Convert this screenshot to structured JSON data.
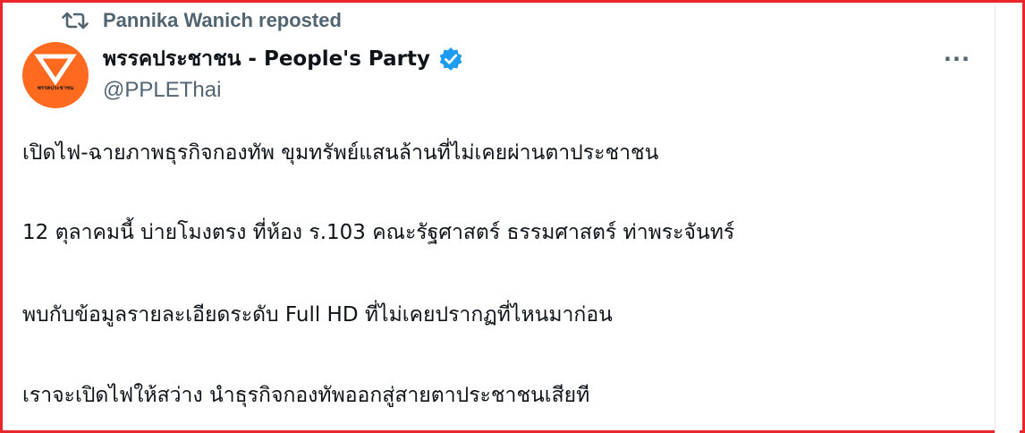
{
  "repost": {
    "icon": "repost-icon",
    "text": "Pannika Wanich reposted"
  },
  "author": {
    "avatar_text": "พรรคประชาชน",
    "avatar_color": "#ff6a1f",
    "display_name": "พรรคประชาชน - People's Party",
    "verified_icon": "verified-badge-icon",
    "verified_color": "#1d9bf0",
    "handle": "@PPLEThai"
  },
  "more_menu": {
    "icon": "more-options-icon",
    "glyph": "···"
  },
  "post": {
    "lines": [
      "เปิดไฟ-ฉายภาพธุรกิจกองทัพ ขุมทรัพย์แสนล้านที่ไม่เคยผ่านตาประชาชน",
      "12 ตุลาคมนี้ บ่ายโมงตรง ที่ห้อง ร.103 คณะรัฐศาสตร์ ธรรมศาสตร์ ท่าพระจันทร์",
      "พบกับข้อมูลรายละเอียดระดับ Full HD ที่ไม่เคยปรากฏที่ไหนมาก่อน",
      "เราจะเปิดไฟให้สว่าง นำธุรกิจกองทัพออกสู่สายตาประชาชนเสียที"
    ]
  },
  "colors": {
    "frame_border": "#e8262b",
    "text_primary": "#0f1419",
    "text_secondary": "#536471"
  }
}
